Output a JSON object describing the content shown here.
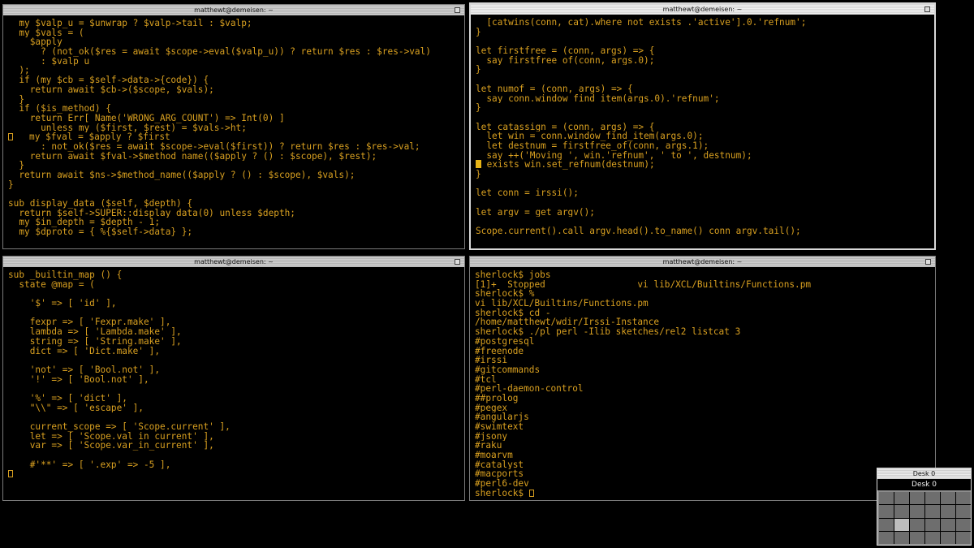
{
  "windows": {
    "top_left": {
      "title": "matthewt@demeisen: ~",
      "lines": [
        "  my $valp_u = $unwrap ? $valp->tail : $valp;",
        "  my $vals = (",
        "    $apply",
        "      ? (not_ok($res = await $scope->eval($valp_u)) ? return $res : $res->val)",
        "      : $valp_u",
        "  );",
        "  if (my $cb = $self->data->{code}) {",
        "    return await $cb->($scope, $vals);",
        "  }",
        "  if ($is_method) {",
        "    return Err[ Name('WRONG_ARG_COUNT') => Int(0) ]",
        "      unless my ($first, $rest) = $vals->ht;",
        "    my $fval = $apply ? $first",
        "      : not_ok($res = await $scope->eval($first)) ? return $res : $res->val;",
        "    return await $fval->$method_name(($apply ? () : $scope), $rest);",
        "  }",
        "  return await $ns->$method_name(($apply ? () : $scope), $vals);",
        "}",
        "",
        "sub display_data ($self, $depth) {",
        "  return $self->SUPER::display_data(0) unless $depth;",
        "  my $in_depth = $depth - 1;",
        "  my $dproto = { %{$self->data} };"
      ]
    },
    "top_right": {
      "title": "matthewt@demeisen: ~",
      "lines": [
        "  [catwins(conn, cat).where not exists .'active'].0.'refnum';",
        "}",
        "",
        "let firstfree = (conn, args) => {",
        "  say firstfree_of(conn, args.0);",
        "}",
        "",
        "let numof = (conn, args) => {",
        "  say conn.window_find_item(args.0).'refnum';",
        "}",
        "",
        "let catassign = (conn, args) => {",
        "  let win = conn.window_find_item(args.0);",
        "  let destnum = firstfree_of(conn, args.1);",
        "  say ++('Moving ', win.'refnum', ' to ', destnum);",
        "  exists win.set_refnum(destnum);",
        "}",
        "",
        "let conn = irssi();",
        "",
        "let argv = get_argv();",
        "",
        "Scope.current().call argv.head().to_name() conn argv.tail();"
      ]
    },
    "bottom_left": {
      "title": "matthewt@demeisen: ~",
      "lines": [
        "sub _builtin_map () {",
        "  state @map = (",
        "",
        "    '$' => [ 'id' ],",
        "",
        "    fexpr => [ 'Fexpr.make' ],",
        "    lambda => [ 'Lambda.make' ],",
        "    string => [ 'String.make' ],",
        "    dict => [ 'Dict.make' ],",
        "",
        "    'not' => [ 'Bool.not' ],",
        "    '!' => [ 'Bool.not' ],",
        "",
        "    '%' => [ 'dict' ],",
        "    \"\\\\\" => [ 'escape' ],",
        "",
        "    current_scope => [ 'Scope.current' ],",
        "    let => [ 'Scope.val_in_current' ],",
        "    var => [ 'Scope.var_in_current' ],",
        "",
        "    #'**' => [ '.exp' => -5 ],"
      ]
    },
    "bottom_right": {
      "title": "matthewt@demeisen: ~",
      "lines": [
        "sherlock$ jobs",
        "[1]+  Stopped                 vi lib/XCL/Builtins/Functions.pm",
        "sherlock$ %",
        "vi lib/XCL/Builtins/Functions.pm",
        "sherlock$ cd -",
        "/home/matthewt/wdir/Irssi-Instance",
        "sherlock$ ./pl perl -Ilib sketches/rel2 listcat 3",
        "#postgresql",
        "#freenode",
        "#irssi",
        "#gitcommands",
        "#tcl",
        "#perl-daemon-control",
        "##prolog",
        "#pegex",
        "#angularjs",
        "#swimtext",
        "#jsony",
        "#raku",
        "#moarvm",
        "#catalyst",
        "#macports",
        "#perl6-dev"
      ],
      "prompt": "sherlock$ "
    }
  },
  "pager": {
    "title": "Desk 0",
    "desktop_name": "Desk 0"
  },
  "colors": {
    "text": "#d9a020",
    "cursor": "#e6b316",
    "background": "#000000"
  }
}
